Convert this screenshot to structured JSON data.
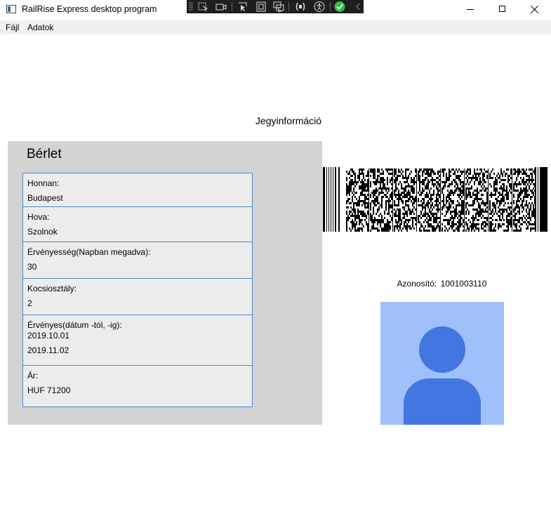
{
  "window": {
    "title": "RailRise Express desktop program",
    "controls": {
      "minimize": "minimize-icon",
      "maximize": "maximize-icon",
      "close": "close-icon"
    }
  },
  "debug_toolbar": {
    "icons": [
      "select-element-icon",
      "record-icon",
      "pointer-icon",
      "bounds-icon",
      "focus-icon",
      "binding-icon",
      "accessibility-icon",
      "check-icon",
      "collapse-icon"
    ],
    "accent_color": "#2ec24a"
  },
  "menu": {
    "items": [
      "Fájl",
      "Adatok"
    ]
  },
  "page": {
    "heading": "Jegyinformáció"
  },
  "ticket": {
    "type": "Bérlet",
    "from": {
      "label": "Honnan:",
      "value": "Budapest"
    },
    "to": {
      "label": "Hova:",
      "value": "Szolnok"
    },
    "validity_days": {
      "label": "Érvényesség(Napban megadva):",
      "value": "30"
    },
    "class": {
      "label": "Kocsiosztály:",
      "value": "2"
    },
    "valid_range": {
      "label": "Érvényes(dátum -tól, -ig):",
      "from": "2019.10.01",
      "to": "2019.11.02"
    },
    "price": {
      "label": "Ár:",
      "value": "HUF 71200"
    }
  },
  "identity": {
    "label": "Azonosító:",
    "value": "1001003110",
    "barcode_icon": "barcode-icon",
    "photo_icon": "person-placeholder-icon"
  },
  "colors": {
    "panel_bg": "#d3d3d3",
    "field_border": "#4a8ac8",
    "avatar_bg": "#a0c0fb",
    "avatar_fg": "#4376e0"
  }
}
